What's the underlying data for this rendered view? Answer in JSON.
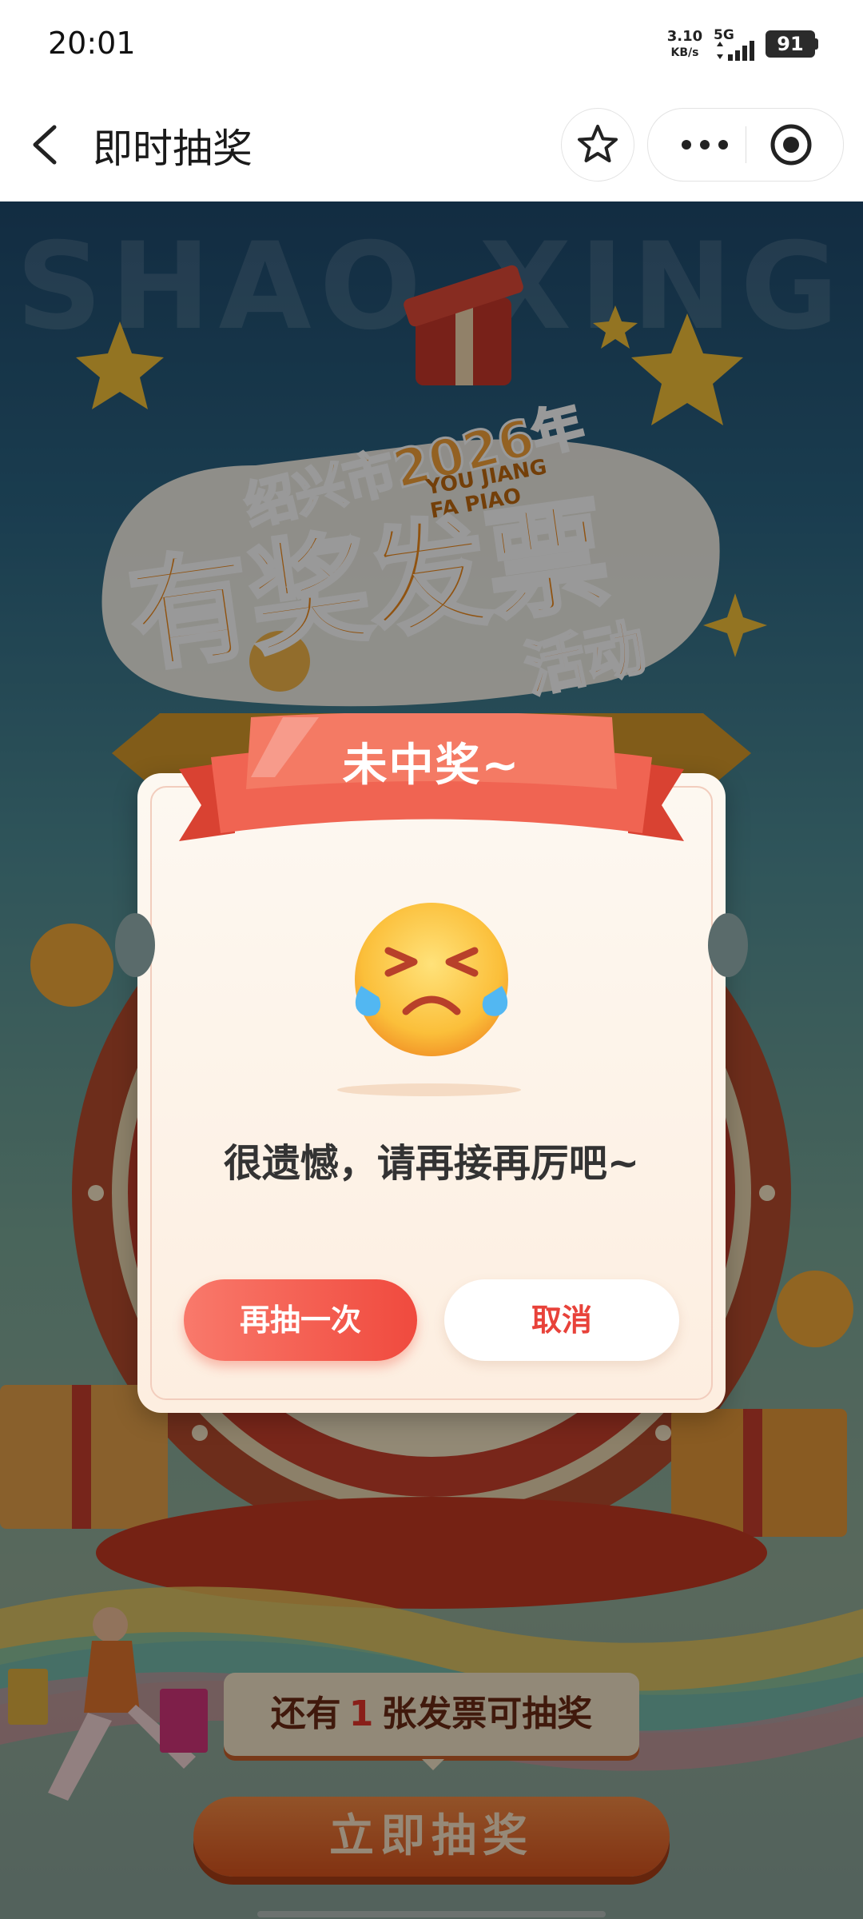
{
  "status_bar": {
    "time": "20:01",
    "net_speed_value": "3.10",
    "net_speed_unit": "KB/s",
    "network_type": "5G",
    "battery": "91"
  },
  "nav": {
    "title": "即时抽奖",
    "icons": [
      "back-icon",
      "star-icon",
      "more-icon",
      "target-icon"
    ]
  },
  "background": {
    "watermark": "SHAO XING",
    "logo_year": "绍兴市2026年",
    "logo_pinyin_1": "YOU JIANG",
    "logo_pinyin_2": "FA PIAO",
    "logo_main": "有奖发票",
    "logo_sub": "活动",
    "chance_prefix": "还有",
    "chance_count": "1",
    "chance_suffix": "张发票可抽奖",
    "draw_button": "立即抽奖"
  },
  "dialog": {
    "ribbon_title": "未中奖~",
    "message": "很遗憾，请再接再厉吧~",
    "retry_button": "再抽一次",
    "cancel_button": "取消",
    "emoji": "crying-face-icon"
  },
  "colors": {
    "accent_red": "#f04a3e",
    "ribbon_red": "#ee5a4a",
    "dialog_bg": "#fdf5ec",
    "draw_orange": "#e0602a"
  }
}
